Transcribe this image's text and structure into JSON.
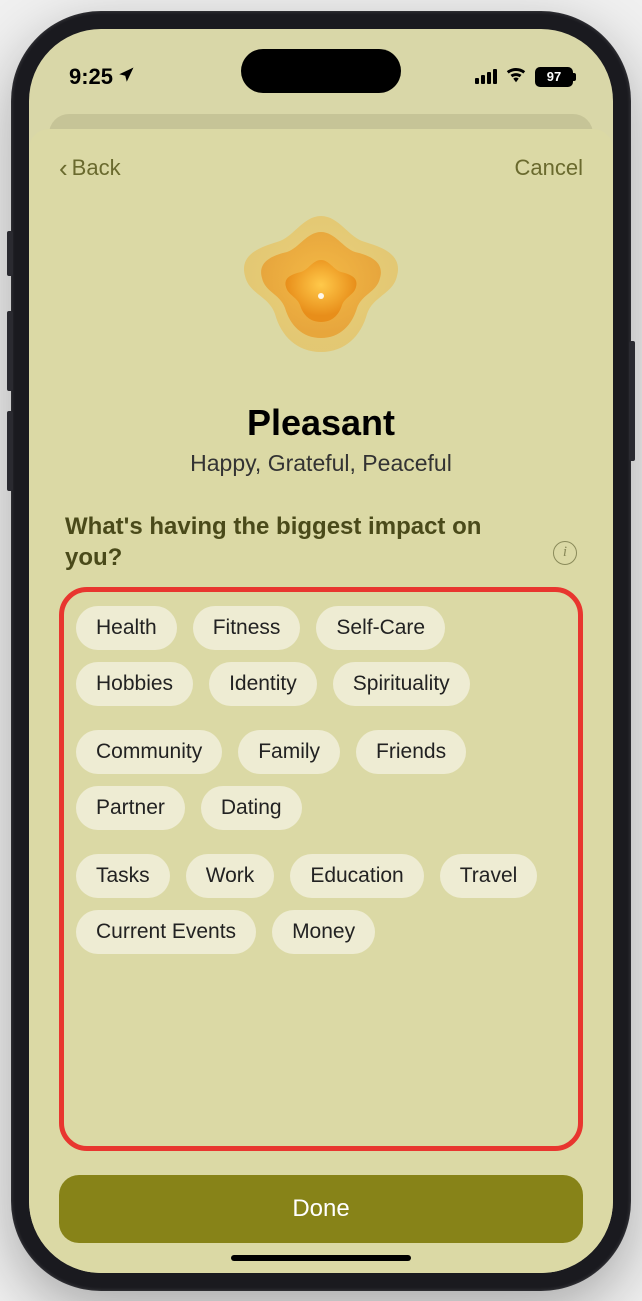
{
  "status": {
    "time": "9:25",
    "battery": "97"
  },
  "nav": {
    "back": "Back",
    "cancel": "Cancel"
  },
  "mood": {
    "title": "Pleasant",
    "subtitle": "Happy, Grateful, Peaceful"
  },
  "question": "What's having the biggest impact on you?",
  "groups": [
    {
      "chips": [
        "Health",
        "Fitness",
        "Self-Care",
        "Hobbies",
        "Identity",
        "Spirituality"
      ]
    },
    {
      "chips": [
        "Community",
        "Family",
        "Friends",
        "Partner",
        "Dating"
      ]
    },
    {
      "chips": [
        "Tasks",
        "Work",
        "Education",
        "Travel",
        "Current Events",
        "Money"
      ]
    }
  ],
  "done": "Done"
}
